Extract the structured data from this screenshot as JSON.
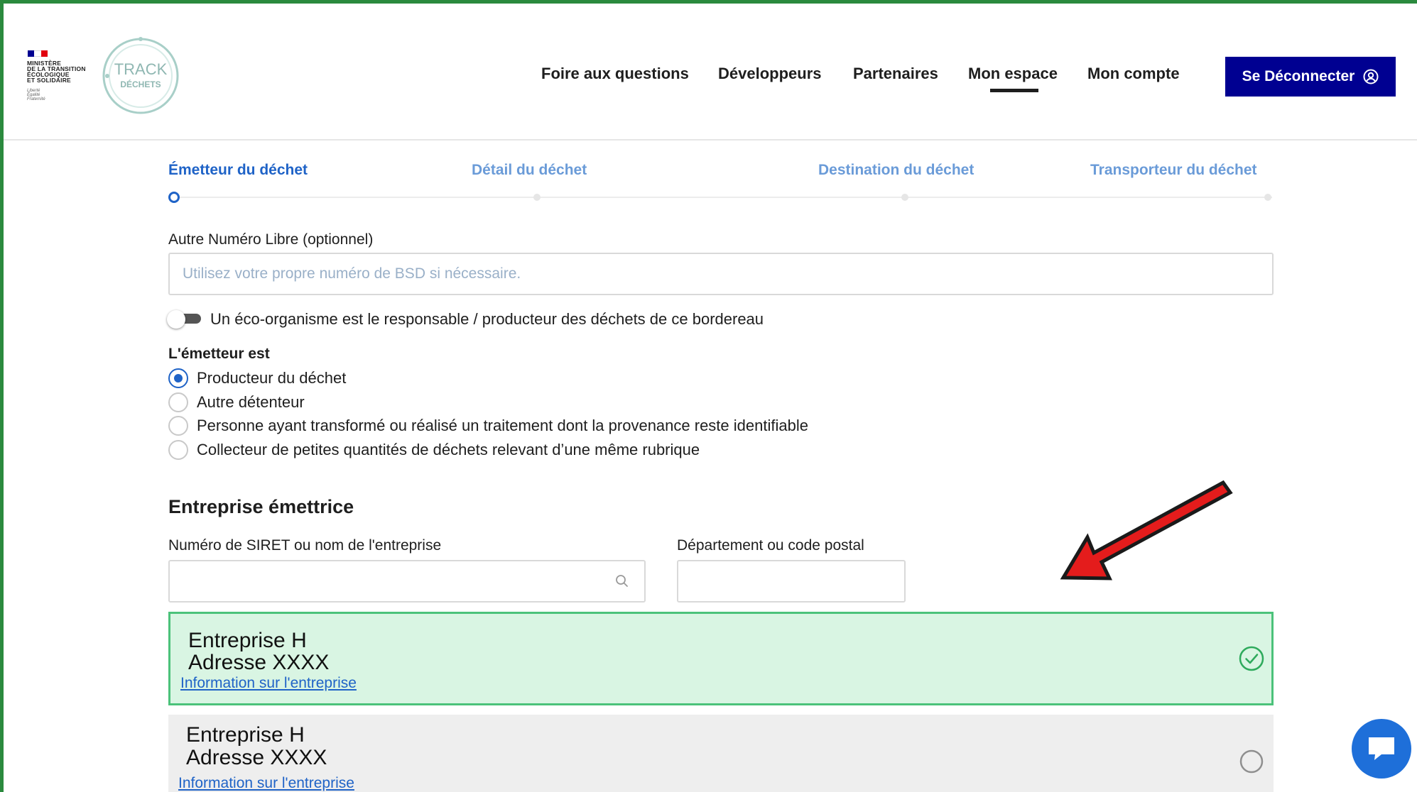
{
  "gov": {
    "ministry_text": "MINISTÈRE\nDE LA TRANSITION\nÉCOLOGIQUE\nET SOLIDAIRE",
    "motto": "Liberté\nÉgalité\nFraternité",
    "flag_colors": [
      "#000091",
      "#ffffff",
      "#e1000f"
    ]
  },
  "brand": {
    "line1": "TRACK",
    "line2": "DÉCHETS",
    "color": "#8fb7b2"
  },
  "nav": {
    "items": [
      "Foire aux questions",
      "Développeurs",
      "Partenaires",
      "Mon espace",
      "Mon compte"
    ],
    "active": "Mon espace",
    "logout_label": "Se Déconnecter",
    "logout_color": "#000091"
  },
  "stepper": {
    "steps": [
      "Émetteur du déchet",
      "Détail du déchet",
      "Destination du déchet",
      "Transporteur du déchet"
    ],
    "active_index": 0,
    "active_color": "#1f63c7"
  },
  "form": {
    "free_number": {
      "label": "Autre Numéro Libre (optionnel)",
      "placeholder": "Utilisez votre propre numéro de BSD si nécessaire.",
      "value": ""
    },
    "eco_toggle": {
      "label": "Un éco-organisme est le responsable / producteur des déchets de ce bordereau",
      "on": false
    },
    "emitter_type": {
      "label": "L'émetteur est",
      "options": [
        "Producteur du déchet",
        "Autre détenteur",
        "Personne ayant transformé ou réalisé un traitement dont la provenance reste identifiable",
        "Collecteur de petites quantités de déchets relevant d’une même rubrique"
      ],
      "selected_index": 0
    },
    "company_section": {
      "title": "Entreprise émettrice",
      "siret_label": "Numéro de SIRET ou nom de l'entreprise",
      "siret_value": "",
      "dept_label": "Département ou code postal",
      "dept_value": "",
      "results": [
        {
          "name": "Entreprise H",
          "address": "Adresse XXXX",
          "link": "Information sur l'entreprise",
          "selected": true
        },
        {
          "name": "Entreprise H",
          "address": "Adresse XXXX",
          "link": "Information sur l'entreprise",
          "selected": false
        }
      ]
    }
  },
  "annotation": {
    "arrow_color": "#e41c1c"
  },
  "chat": {
    "color": "#1e6fd9"
  },
  "frame_color": "#2b8a3e"
}
